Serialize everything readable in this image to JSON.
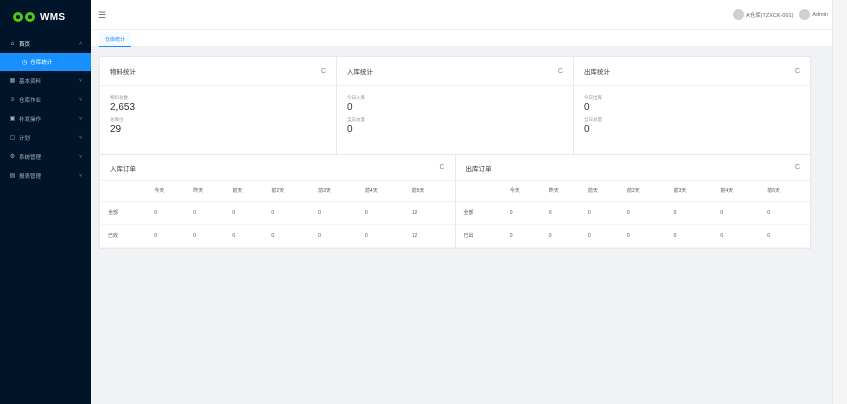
{
  "app": {
    "logo_text": "WMS"
  },
  "sidebar": {
    "items": [
      {
        "label": "首页",
        "icon": "home-icon",
        "glyph": "⌂",
        "chevron": "˄",
        "open": true
      },
      {
        "label": "基本资料",
        "icon": "grid-icon",
        "glyph": "▦",
        "chevron": "˅"
      },
      {
        "label": "仓库作业",
        "icon": "list-icon",
        "glyph": "≡",
        "chevron": "˅"
      },
      {
        "label": "补发操作",
        "icon": "task-icon",
        "glyph": "▣",
        "chevron": "˅"
      },
      {
        "label": "计划",
        "icon": "document-icon",
        "glyph": "▢",
        "chevron": "˅"
      },
      {
        "label": "系统管理",
        "icon": "gear-icon",
        "glyph": "⚙",
        "chevron": "˅"
      },
      {
        "label": "报表管理",
        "icon": "chart-icon",
        "glyph": "▤",
        "chevron": "˅"
      }
    ],
    "active_sub": {
      "label": "仓库统计",
      "icon": "clock-icon",
      "glyph": "◷"
    }
  },
  "header": {
    "fold_glyph": "☰",
    "warehouse_label": "A仓库(TZXCK-001)",
    "user_label": "Admin"
  },
  "tabs": [
    {
      "label": "仓库统计"
    }
  ],
  "stats": [
    {
      "title": "物料统计",
      "rows": [
        {
          "label": "物料总数",
          "value": "2,653"
        },
        {
          "label": "总库位",
          "value": "29"
        }
      ]
    },
    {
      "title": "入库统计",
      "rows": [
        {
          "label": "今日入库",
          "value": "0"
        },
        {
          "label": "当日总量",
          "value": "0"
        }
      ]
    },
    {
      "title": "出库统计",
      "rows": [
        {
          "label": "今日出库",
          "value": "0"
        },
        {
          "label": "当日总量",
          "value": "0"
        }
      ]
    }
  ],
  "refresh_glyph": "C",
  "inbound_table": {
    "title": "入库订单",
    "headers": [
      "",
      "今天",
      "昨天",
      "前天",
      "前2天",
      "前3天",
      "前4天",
      "前5天"
    ],
    "rows": [
      {
        "label": "全部",
        "cells": [
          "0",
          "0",
          "0",
          "0",
          "0",
          "0",
          "12"
        ]
      },
      {
        "label": "已收",
        "cells": [
          "0",
          "0",
          "0",
          "0",
          "0",
          "0",
          "12"
        ]
      }
    ]
  },
  "outbound_table": {
    "title": "出库订单",
    "headers": [
      "",
      "今天",
      "昨天",
      "前天",
      "前2天",
      "前3天",
      "前4天",
      "前5天"
    ],
    "rows": [
      {
        "label": "全部",
        "cells": [
          "0",
          "0",
          "0",
          "0",
          "0",
          "0",
          "0"
        ]
      },
      {
        "label": "已出",
        "cells": [
          "0",
          "0",
          "0",
          "0",
          "0",
          "0",
          "0"
        ]
      }
    ]
  }
}
